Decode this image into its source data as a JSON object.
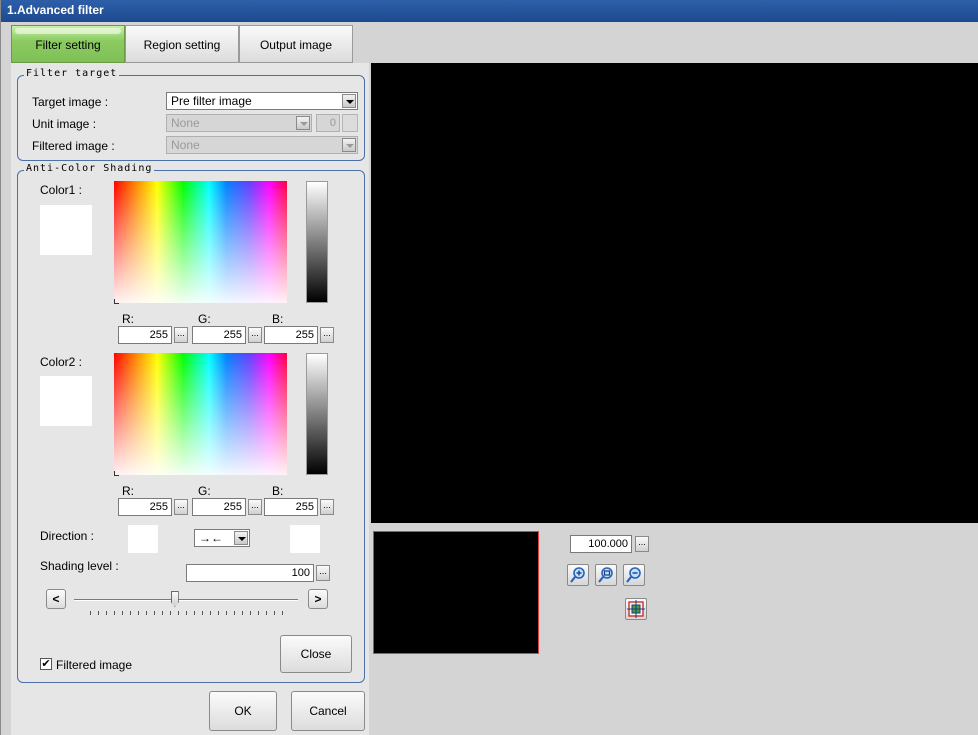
{
  "window": {
    "title": "1.Advanced filter"
  },
  "tabs": [
    {
      "label": "Filter setting",
      "active": true
    },
    {
      "label": "Region setting",
      "active": false
    },
    {
      "label": "Output image",
      "active": false
    }
  ],
  "filter_target": {
    "group_title": "Filter target",
    "target_image_label": "Target image :",
    "target_image_value": "Pre filter image",
    "unit_image_label": "Unit image :",
    "unit_image_value": "None",
    "unit_image_number": "0",
    "filtered_image_label": "Filtered image :",
    "filtered_image_value": "None"
  },
  "anti_color_shading": {
    "group_title": "Anti-Color Shading",
    "color1": {
      "label": "Color1 :",
      "r_label": "R:",
      "g_label": "G:",
      "b_label": "B:",
      "r": "255",
      "g": "255",
      "b": "255"
    },
    "color2": {
      "label": "Color2 :",
      "r_label": "R:",
      "g_label": "G:",
      "b_label": "B:",
      "r": "255",
      "g": "255",
      "b": "255"
    },
    "direction_label": "Direction :",
    "direction_value": "→←",
    "shading_level_label": "Shading level :",
    "shading_level_value": "100",
    "slider_left": "<",
    "slider_right": ">",
    "slider_fraction": 0.45,
    "filtered_image_checkbox_label": "Filtered image",
    "filtered_image_checked": true,
    "close_label": "Close"
  },
  "dialog_buttons": {
    "ok_label": "OK",
    "cancel_label": "Cancel"
  },
  "viewer": {
    "zoom_value": "100.000",
    "ellipsis": "..."
  },
  "colors": {
    "tab_active": "#8ccb62",
    "title_bar": "#2d5fa8",
    "group_border": "#4c6fa8",
    "thumbnail_border": "#e04040"
  }
}
